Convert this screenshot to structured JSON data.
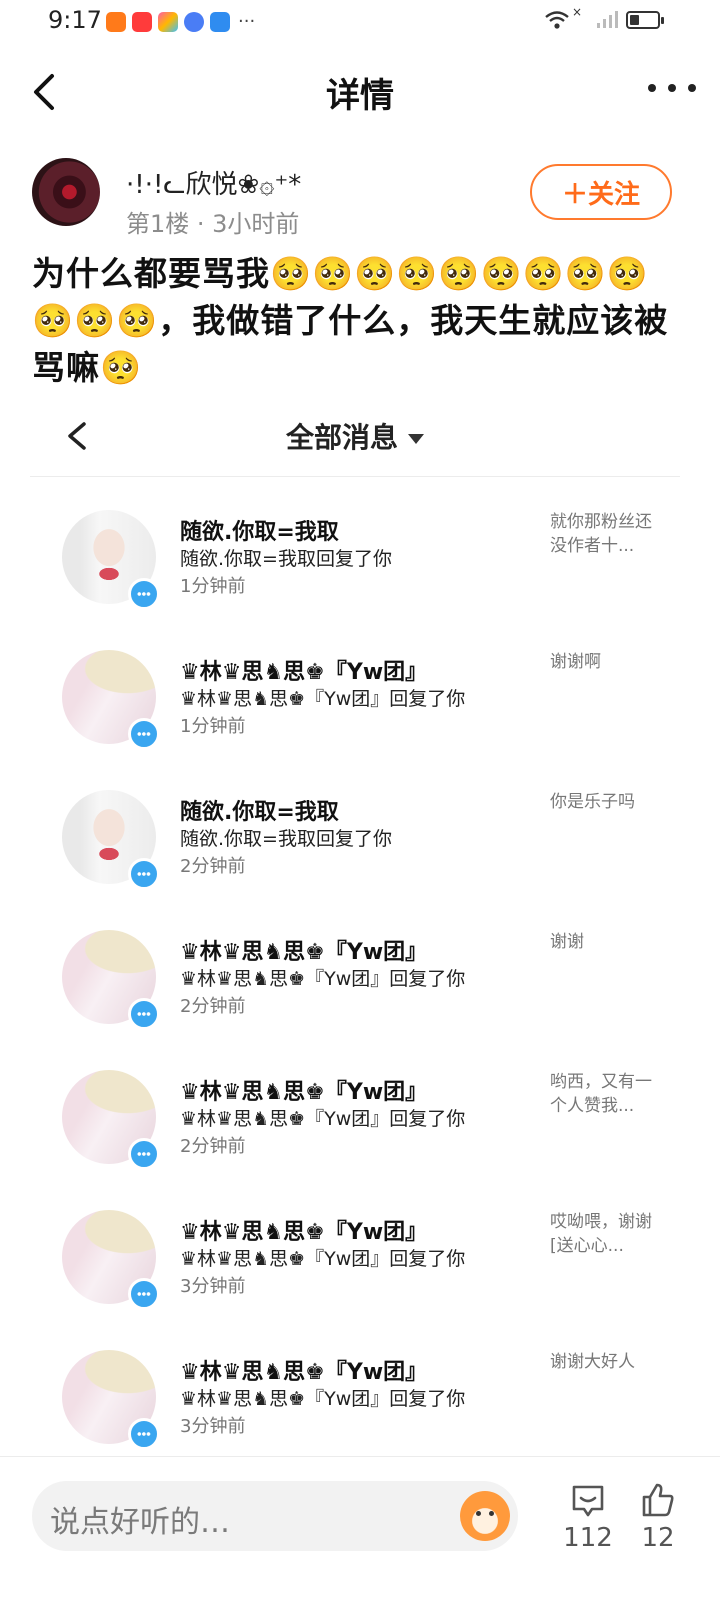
{
  "status_bar": {
    "time": "9:17",
    "more": "···",
    "wifi_x": "×"
  },
  "nav": {
    "title": "详情"
  },
  "author": {
    "name": "·!·!ᓚ欣悦❀۞⁺*",
    "meta": "第1楼 · 3小时前",
    "follow_label": "＋关注"
  },
  "post": {
    "text": "为什么都要骂我🥺🥺🥺🥺🥺🥺🥺🥺🥺🥺🥺🥺，我做错了什么，我天生就应该被骂嘛🥺"
  },
  "embedded": {
    "title": "全部消息",
    "messages": [
      {
        "name": "随欲.你取=我取",
        "sub": "随欲.你取=我取回复了你",
        "time": "1分钟前",
        "preview": "就你那粉丝还没作者十...",
        "avatar": "girl"
      },
      {
        "name": "♛林♛思♞思♚『Yw团』",
        "sub": "♛林♛思♞思♚『Yw团』回复了你",
        "time": "1分钟前",
        "preview": "谢谢啊",
        "avatar": "hat"
      },
      {
        "name": "随欲.你取=我取",
        "sub": "随欲.你取=我取回复了你",
        "time": "2分钟前",
        "preview": "你是乐子吗",
        "avatar": "girl"
      },
      {
        "name": "♛林♛思♞思♚『Yw团』",
        "sub": "♛林♛思♞思♚『Yw团』回复了你",
        "time": "2分钟前",
        "preview": "谢谢",
        "avatar": "hat"
      },
      {
        "name": "♛林♛思♞思♚『Yw团』",
        "sub": "♛林♛思♞思♚『Yw团』回复了你",
        "time": "2分钟前",
        "preview": "哟西，又有一个人赞我...",
        "avatar": "hat"
      },
      {
        "name": "♛林♛思♞思♚『Yw团』",
        "sub": "♛林♛思♞思♚『Yw团』回复了你",
        "time": "3分钟前",
        "preview": "哎呦喂，谢谢[送心心...",
        "avatar": "hat"
      },
      {
        "name": "♛林♛思♞思♚『Yw团』",
        "sub": "♛林♛思♞思♚『Yw团』回复了你",
        "time": "3分钟前",
        "preview": "谢谢大好人",
        "avatar": "hat"
      }
    ]
  },
  "bottom": {
    "placeholder": "说点好听的…",
    "comment_count": "112",
    "like_count": "12"
  },
  "icons": {
    "back": "back-arrow-icon",
    "more": "more-dots-icon",
    "comment": "comment-icon",
    "like": "thumbs-up-icon",
    "mascot": "mascot-icon"
  },
  "colors": {
    "accent": "#ff6b1a",
    "badge": "#3aa6f0"
  }
}
